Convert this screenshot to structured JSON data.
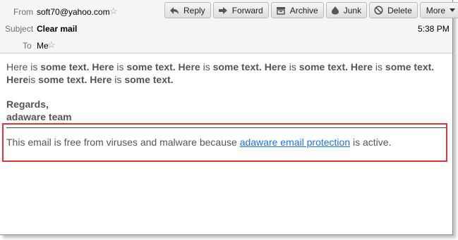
{
  "header": {
    "from_label": "From",
    "from_value": "soft70@yahoo.com",
    "subject_label": "Subject",
    "subject_value": "Clear mail",
    "to_label": "To",
    "to_value": "Me",
    "time": "5:38 PM"
  },
  "toolbar": {
    "reply": "Reply",
    "forward": "Forward",
    "archive": "Archive",
    "junk": "Junk",
    "delete": "Delete",
    "more": "More"
  },
  "message": {
    "p1": "Here is ",
    "b1": "some text. Here",
    "p2": " is ",
    "b2": "some text. Here",
    "p3": " is ",
    "b3": "some text. Here",
    "p4": " is ",
    "b4": "some text. Here",
    "p5": " is ",
    "b5": "some text. Here",
    "p6": "is ",
    "b6": "some text. Here",
    "p7": " is ",
    "b7": "some text.",
    "regards": "Regards,",
    "team": "adaware team"
  },
  "footer": {
    "before": "This email is free from viruses and malware because ",
    "link": "adaware email protection",
    "after": " is active."
  },
  "colors": {
    "highlight_border": "#e0343c",
    "link": "#1a73e8"
  },
  "icons": [
    "reply-icon",
    "forward-icon",
    "archive-icon",
    "junk-icon",
    "delete-icon",
    "chevron-down-icon",
    "star-icon"
  ]
}
